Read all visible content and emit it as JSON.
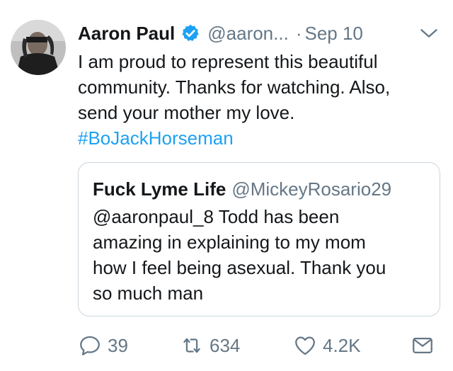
{
  "tweet": {
    "author_name": "Aaron Paul",
    "handle": "@aaron...",
    "separator": "·",
    "date": "Sep 10",
    "text_lines": [
      "I am proud to represent this beautiful",
      "community. Thanks for watching. Also,",
      "send your mother my love."
    ],
    "hashtag": "#BoJackHorseman"
  },
  "quoted_tweet": {
    "author_name": "Fuck Lyme Life",
    "handle": "@MickeyRosario29",
    "text_lines": [
      "@aaronpaul_8 Todd has been",
      "amazing in explaining to my mom",
      "how I feel being asexual. Thank you",
      "so much man"
    ]
  },
  "actions": {
    "replies": "39",
    "retweets": "634",
    "likes": "4.2K"
  },
  "icons": {
    "verified": "verified-badge-icon",
    "caret": "chevron-down-icon",
    "reply": "reply-icon",
    "retweet": "retweet-icon",
    "like": "heart-icon",
    "dm": "envelope-icon"
  },
  "colors": {
    "accent": "#1da1f2",
    "muted": "#657786",
    "text": "#14171a",
    "border": "#ccd6dd"
  }
}
